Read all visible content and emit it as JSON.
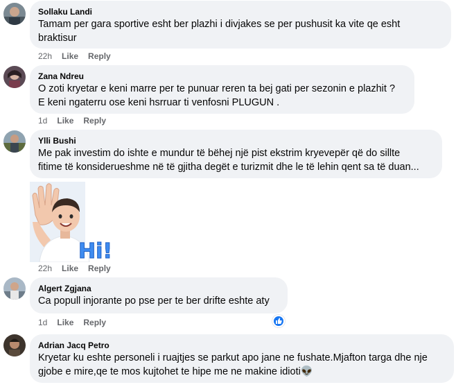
{
  "comments": [
    {
      "author": "Sollaku Landi",
      "lines": [
        "Tamam per gara sportive esht ber plazhi i divjakes se per pushusit ka vite qe esht",
        "braktisur"
      ],
      "time": "22h",
      "like": "Like",
      "reply": "Reply"
    },
    {
      "author": "Zana Ndreu",
      "lines": [
        "O zoti kryetar e keni marre per te punuar reren ta bej gati per sezonin e plazhit ?",
        "E keni ngaterru ose keni hsrruar ti venfosni PLUGUN ."
      ],
      "time": "1d",
      "like": "Like",
      "reply": "Reply"
    },
    {
      "author": "Ylli Bushi",
      "lines": [
        "Me pak investim do ishte e mundur të bëhej një pist ekstrim kryevepër që do sillte",
        "fitime të konsiderueshme në të gjitha degët e turizmit dhe le të lehin qent sa të duan..."
      ],
      "time": "22h",
      "like": "Like",
      "reply": "Reply",
      "sticker_text": "Hi!"
    },
    {
      "author": "Algert Zgjana",
      "lines": [
        "Ca popull injorante po pse per te ber drifte eshte aty"
      ],
      "time": "1d",
      "like": "Like",
      "reply": "Reply",
      "reaction": "like-reaction-icon"
    },
    {
      "author": "Adrian Jacq Petro",
      "lines": [
        "Kryetar ku eshte personeli i ruajtjes se parkut apo jane ne fushate.Mjafton targa dhe nje",
        "gjobe e mire,qe te mos kujtohet te hipe me ne makine idioti👽"
      ]
    }
  ],
  "colors": {
    "bubble": "#f0f2f5",
    "meta": "#65676b",
    "accent": "#1877f2"
  }
}
